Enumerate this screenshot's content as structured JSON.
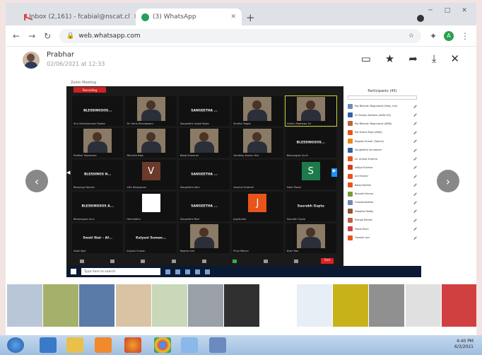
{
  "browser": {
    "tabs": [
      {
        "label": "Inbox (2,161) - fcabial@nscat.cl",
        "icon": "gmail-icon"
      },
      {
        "label": "(3) WhatsApp",
        "icon": "whatsapp-icon"
      }
    ],
    "new_tab": "+",
    "url": "web.whatsapp.com",
    "window_controls": [
      "─",
      "□",
      "✕"
    ],
    "profile_initial": "A"
  },
  "viewer": {
    "sender": "Prabhar",
    "sent_time": "02/06/2021 at 12:33",
    "actions": [
      "monitor-icon",
      "star-icon",
      "share-icon",
      "download-icon",
      "close-icon"
    ],
    "prev": "‹",
    "next": "›"
  },
  "zoom": {
    "window_title": "Zoom Meeting",
    "recording_label": "Recording",
    "participants_title": "Participants (45)",
    "tiles": [
      {
        "name": "BLESSINGSOS...",
        "caption": "Sriu Visishwaramy Rajeev",
        "kind": "text"
      },
      {
        "name": "",
        "caption": "Dr. Haris Dhandapani",
        "kind": "photo"
      },
      {
        "name": "SANGEETHA ...",
        "caption": "Sangeetha Gopal Rajan",
        "kind": "text"
      },
      {
        "name": "",
        "caption": "Sindhul Dagar",
        "kind": "photo"
      },
      {
        "name": "",
        "caption": "Sindhu Mathews Sri",
        "kind": "photo",
        "highlight": true
      },
      {
        "name": "",
        "caption": "Prabhar Rajeshwar",
        "kind": "photo"
      },
      {
        "name": "",
        "caption": "Manisha Raja",
        "kind": "photo"
      },
      {
        "name": "",
        "caption": "Balaji Kumaran",
        "kind": "photo"
      },
      {
        "name": "",
        "caption": "Sandeep Kumar Vish",
        "kind": "photo"
      },
      {
        "name": "BLESSINGSOS...",
        "caption": "Blessingsos Sunil",
        "kind": "text"
      },
      {
        "name": "BLESSINGS N...",
        "caption": "Blessings Naresh",
        "kind": "text"
      },
      {
        "name": "V",
        "caption": "Vish Narayanan",
        "kind": "letter",
        "color": "#6b3a2a"
      },
      {
        "name": "SANGEETHA ...",
        "caption": "Sangeetha Abhi",
        "kind": "text"
      },
      {
        "name": "",
        "caption": "Aravind Sudarsh",
        "kind": "dark"
      },
      {
        "name": "S",
        "caption": "Sahit Pawar",
        "kind": "letter",
        "color": "#1e7a4a"
      },
      {
        "name": "BLESSINGSOS A...",
        "caption": "Blessingsos Arun",
        "kind": "text"
      },
      {
        "name": "",
        "caption": "Hemalatha",
        "kind": "white"
      },
      {
        "name": "SANGEETHA ...",
        "caption": "Sangeetha Ravi",
        "kind": "text"
      },
      {
        "name": "J",
        "caption": "Jayakumar",
        "kind": "letter",
        "color": "#e8541a"
      },
      {
        "name": "Saurabh Gupta",
        "caption": "Saurabh Gupta",
        "kind": "text"
      },
      {
        "name": "Swati Nair - Af...",
        "caption": "Swati Nair",
        "kind": "text"
      },
      {
        "name": "Kalyani Suman...",
        "caption": "Kalyani Suman",
        "kind": "text"
      },
      {
        "name": "",
        "caption": "Raghav Iyer",
        "kind": "photo"
      },
      {
        "name": "",
        "caption": "Priya Menon",
        "kind": "dark"
      },
      {
        "name": "",
        "caption": "Kiran Rao",
        "kind": "photo"
      }
    ],
    "participants": [
      {
        "name": "Raj Bhinesh Ragunandi (Host, me)",
        "color": "#6b8bb8"
      },
      {
        "name": "Dr Sanjay Asthana (ANSJ HQ)",
        "color": "#3a5fa0"
      },
      {
        "name": "Raj Bhinesh Ragunandi (ANSJ)",
        "color": "#c06040"
      },
      {
        "name": "Raj Kumar Raja (ANSJ)",
        "color": "#e8541a"
      },
      {
        "name": "Raghav Kumar (Trainer)",
        "color": "#e88a1a"
      },
      {
        "name": "Sangeetha Sundaram",
        "color": "#3a5fa0"
      },
      {
        "name": "Dr. Ankita Sharma",
        "color": "#e8541a"
      },
      {
        "name": "Aditya Krishna",
        "color": "#d0401a"
      },
      {
        "name": "Anil Kumar",
        "color": "#e8541a"
      },
      {
        "name": "Balaji Karthik",
        "color": "#e8541a"
      },
      {
        "name": "Bharath Kumar",
        "color": "#7a9a3a"
      },
      {
        "name": "Chandrasekhar",
        "color": "#6b8bb8"
      },
      {
        "name": "Deepika Reddy",
        "color": "#8a5a3a"
      },
      {
        "name": "Elango Raman",
        "color": "#c06040"
      },
      {
        "name": "Faizal Khan",
        "color": "#d04050"
      },
      {
        "name": "Ganesh Iyer",
        "color": "#e8541a"
      }
    ],
    "footer_buttons": [
      "Invite",
      "Mute All",
      "..."
    ],
    "end_label": "End",
    "taskbar_search": "Type here to search"
  },
  "thumbnails": [
    {
      "color": "#b8c6d8"
    },
    {
      "color": "#a5b06a"
    },
    {
      "color": "#5a7aa8"
    },
    {
      "color": "#d8c4a4"
    },
    {
      "color": "#c8d8b8"
    },
    {
      "color": "#9aa0a8"
    },
    {
      "color": "#303030"
    },
    {
      "color": "#ffffff"
    },
    {
      "color": "#e8eef6"
    },
    {
      "color": "#c8b21a"
    },
    {
      "color": "#909090"
    },
    {
      "color": "#e0e0e0"
    },
    {
      "color": "#d04040"
    }
  ],
  "os": {
    "clock_time": "4:40 PM",
    "clock_date": "6/3/2021"
  }
}
